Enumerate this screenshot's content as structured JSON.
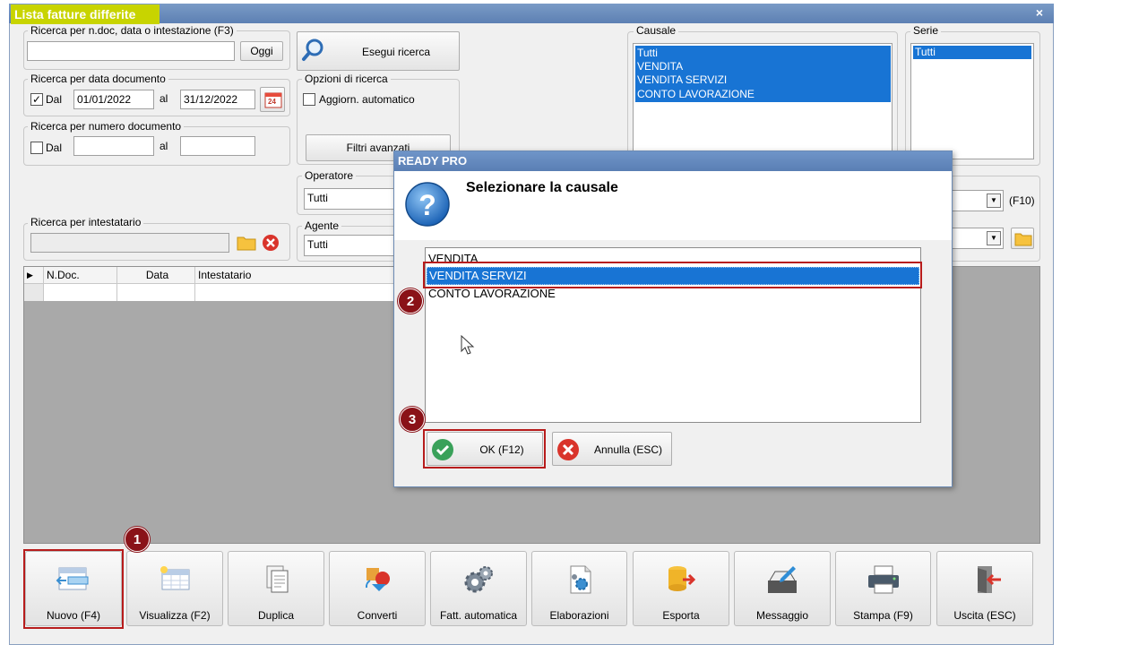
{
  "window": {
    "title": "Lista fatture differite",
    "close_glyph": "×"
  },
  "search_text": {
    "label": "Ricerca per n.doc, data o intestazione (F3)",
    "value": "",
    "today_button": "Oggi"
  },
  "execute_button": "Esegui ricerca",
  "date_search": {
    "label": "Ricerca per data documento",
    "dal_label": "Dal",
    "dal_checked": true,
    "from": "01/01/2022",
    "al_label": "al",
    "to": "31/12/2022",
    "calendar_day": "24"
  },
  "number_search": {
    "label": "Ricerca per numero documento",
    "dal_label": "Dal",
    "dal_checked": false,
    "from": "",
    "al_label": "al",
    "to": ""
  },
  "options": {
    "label": "Opzioni di ricerca",
    "auto_update_label": "Aggiorn. automatico",
    "auto_update_checked": false,
    "advanced_filters": "Filtri avanzati"
  },
  "operator": {
    "label": "Operatore",
    "value": "Tutti"
  },
  "agent": {
    "label": "Agente",
    "value": "Tutti"
  },
  "holder_search": {
    "label": "Ricerca per intestatario",
    "value": ""
  },
  "causale": {
    "label": "Causale",
    "items": [
      "Tutti",
      "VENDITA",
      "VENDITA SERVIZI",
      "CONTO LAVORAZIONE"
    ]
  },
  "serie": {
    "label": "Serie",
    "items": [
      "Tutti"
    ]
  },
  "right_combo_shortcut": "(F10)",
  "grid": {
    "columns": [
      "N.Doc.",
      "Data",
      "Intestatario"
    ]
  },
  "toolbar": [
    {
      "label": "Nuovo (F4)",
      "icon": "new-document-icon"
    },
    {
      "label": "Visualizza (F2)",
      "icon": "view-document-icon"
    },
    {
      "label": "Duplica",
      "icon": "duplicate-icon"
    },
    {
      "label": "Converti",
      "icon": "convert-icon"
    },
    {
      "label": "Fatt. automatica",
      "icon": "gears-icon"
    },
    {
      "label": "Elaborazioni",
      "icon": "processing-icon"
    },
    {
      "label": "Esporta",
      "icon": "export-icon"
    },
    {
      "label": "Messaggio",
      "icon": "message-icon"
    },
    {
      "label": "Stampa (F9)",
      "icon": "printer-icon"
    },
    {
      "label": "Uscita (ESC)",
      "icon": "exit-icon"
    }
  ],
  "dialog": {
    "title": "READY PRO",
    "question": "Selezionare la causale",
    "options": [
      "VENDITA",
      "VENDITA SERVIZI",
      "CONTO LAVORAZIONE"
    ],
    "selected": "VENDITA SERVIZI",
    "ok_button": "OK (F12)",
    "cancel_button": "Annulla (ESC)"
  },
  "steps": [
    "1",
    "2",
    "3"
  ],
  "colors": {
    "selection": "#1874d4",
    "highlight": "#b71c1c",
    "badge": "#8a1218",
    "title_bg": "#c8d400",
    "grid_bg": "#a9a9a9"
  }
}
